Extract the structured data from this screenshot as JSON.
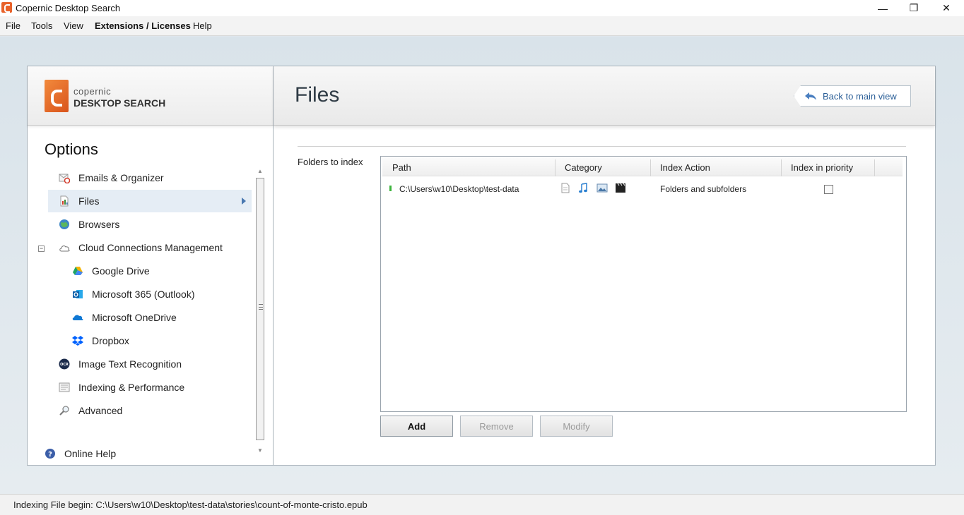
{
  "window": {
    "title": "Copernic Desktop Search",
    "controls": {
      "minimize": "—",
      "restore": "❐",
      "close": "✕"
    }
  },
  "menu": [
    "File",
    "Tools",
    "View",
    "Extensions / Licenses",
    "Help"
  ],
  "logo": {
    "small": "copernic",
    "big": "DESKTOP SEARCH"
  },
  "options": {
    "title": "Options",
    "items": [
      {
        "label": "Emails & Organizer",
        "icon": "email-organizer-icon"
      },
      {
        "label": "Files",
        "icon": "files-icon",
        "selected": true
      },
      {
        "label": "Browsers",
        "icon": "globe-icon"
      },
      {
        "label": "Cloud Connections Management",
        "icon": "cloud-icon"
      },
      {
        "label": "Google Drive",
        "icon": "google-drive-icon"
      },
      {
        "label": "Microsoft 365 (Outlook)",
        "icon": "outlook-icon"
      },
      {
        "label": "Microsoft OneDrive",
        "icon": "onedrive-icon"
      },
      {
        "label": "Dropbox",
        "icon": "dropbox-icon"
      },
      {
        "label": "Image Text Recognition",
        "icon": "ocr-icon"
      },
      {
        "label": "Indexing & Performance",
        "icon": "indexing-icon"
      },
      {
        "label": "Advanced",
        "icon": "magnifier-icon"
      }
    ],
    "online_help": "Online Help"
  },
  "content": {
    "title": "Files",
    "back_button": "Back to main view",
    "folders_label": "Folders to index",
    "columns": [
      "Path",
      "Category",
      "Index Action",
      "Index in priority"
    ],
    "rows": [
      {
        "path": "C:\\Users\\w10\\Desktop\\test-data",
        "categories": [
          "document-icon",
          "music-icon",
          "image-icon",
          "video-icon"
        ],
        "index_action": "Folders and subfolders",
        "index_in_priority": false
      }
    ],
    "buttons": {
      "add": "Add",
      "remove": "Remove",
      "modify": "Modify"
    }
  },
  "status": "Indexing File begin: C:\\Users\\w10\\Desktop\\test-data\\stories\\count-of-monte-cristo.epub",
  "colors": {
    "accent": "#2a5e97",
    "brand": "#e8622a",
    "selected_bg": "#e5edf5"
  }
}
